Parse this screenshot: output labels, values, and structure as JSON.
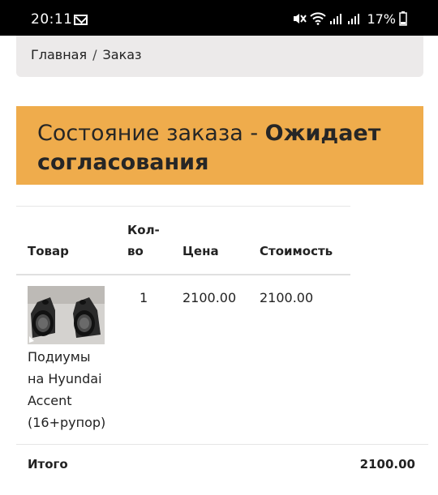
{
  "status_bar": {
    "time": "20:11",
    "battery": "17%"
  },
  "breadcrumb": {
    "home": "Главная",
    "separator": "/",
    "current": "Заказ"
  },
  "order": {
    "status_label": "Состояние заказа - ",
    "status_value_line1": "Ожидает",
    "status_value_line2": "согласования"
  },
  "table": {
    "headers": {
      "product": "Товар",
      "qty_line1": "Кол-",
      "qty_line2": "во",
      "price": "Цена",
      "cost": "Стоимость"
    },
    "rows": [
      {
        "name_lines": [
          "Подиумы",
          "на Hyundai",
          "Accent",
          "(16+рупор)"
        ],
        "qty": "1",
        "price": "2100.00",
        "cost": "2100.00"
      }
    ],
    "total_label": "Итого",
    "total_value": "2100.00"
  },
  "colors": {
    "status_bg": "#efac4c",
    "breadcrumb_bg": "#eceaea"
  }
}
